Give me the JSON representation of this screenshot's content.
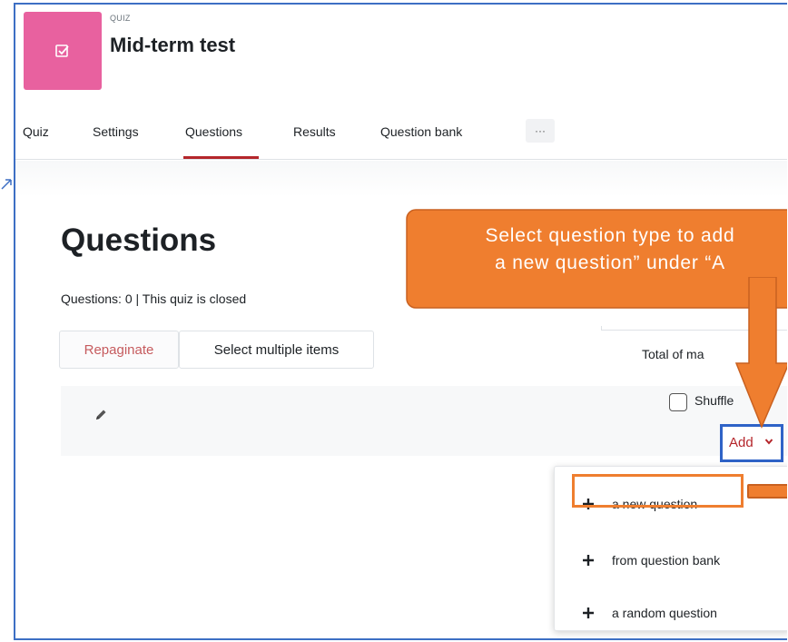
{
  "header": {
    "module_label": "QUIZ",
    "title": "Mid-term test"
  },
  "tabs": [
    {
      "label": "Quiz"
    },
    {
      "label": "Settings"
    },
    {
      "label": "Questions"
    },
    {
      "label": "Results"
    },
    {
      "label": "Question bank"
    }
  ],
  "more_tabs_label": "···",
  "main": {
    "heading": "Questions",
    "info": "Questions: 0 | This quiz is closed",
    "repaginate_label": "Repaginate",
    "select_multiple_label": "Select multiple items",
    "total_marks_label": "Total of ma",
    "shuffle_label": "Shuffle",
    "add_label": "Add"
  },
  "add_menu": [
    {
      "label": "a new question"
    },
    {
      "label": "from question bank"
    },
    {
      "label": "a random question"
    }
  ],
  "callout": {
    "line1": "Select question type to add",
    "line2": "a new question” under “A"
  },
  "colors": {
    "quiz_icon": "#e8619f",
    "active_tab_underline": "#b5262b",
    "callout_fill": "#ef7e2f",
    "add_highlight": "#2f63c7",
    "frame": "#3d6fc4"
  }
}
